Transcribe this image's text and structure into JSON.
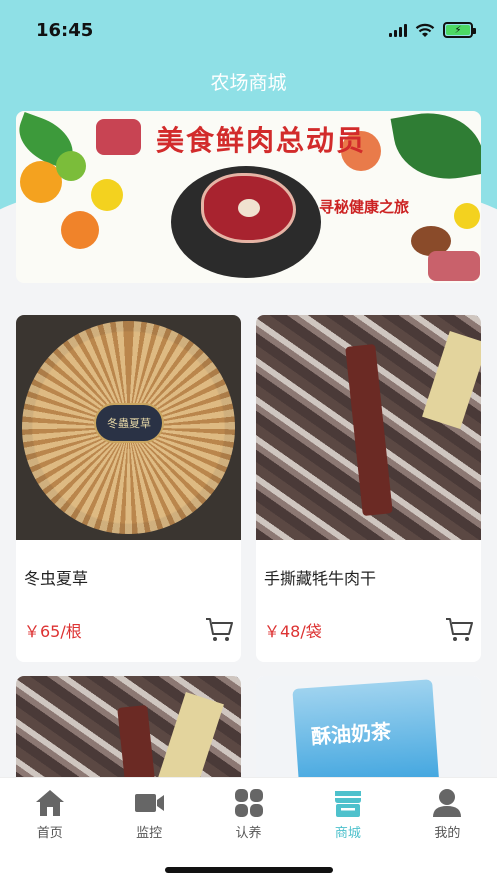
{
  "status": {
    "time": "16:45"
  },
  "nav": {
    "title": "农场商城"
  },
  "banner": {
    "headline": "美食鲜肉总动员",
    "subline": "寻秘健康之旅"
  },
  "products": [
    {
      "name": "冬虫夏草",
      "price": "￥65/根",
      "image_label": "冬蟲夏草"
    },
    {
      "name": "手撕藏牦牛肉干",
      "price": "￥48/袋"
    },
    {
      "name": ""
    },
    {
      "name": "",
      "image_label": "酥油奶茶"
    }
  ],
  "tabs": [
    {
      "label": "首页",
      "icon": "home-icon"
    },
    {
      "label": "监控",
      "icon": "camera-icon"
    },
    {
      "label": "认养",
      "icon": "grid-icon"
    },
    {
      "label": "商城",
      "icon": "shop-icon",
      "active": true
    },
    {
      "label": "我的",
      "icon": "user-icon"
    }
  ],
  "colors": {
    "accent": "#4ec1cc",
    "header": "#8fe0e6",
    "price": "#dd3333"
  }
}
